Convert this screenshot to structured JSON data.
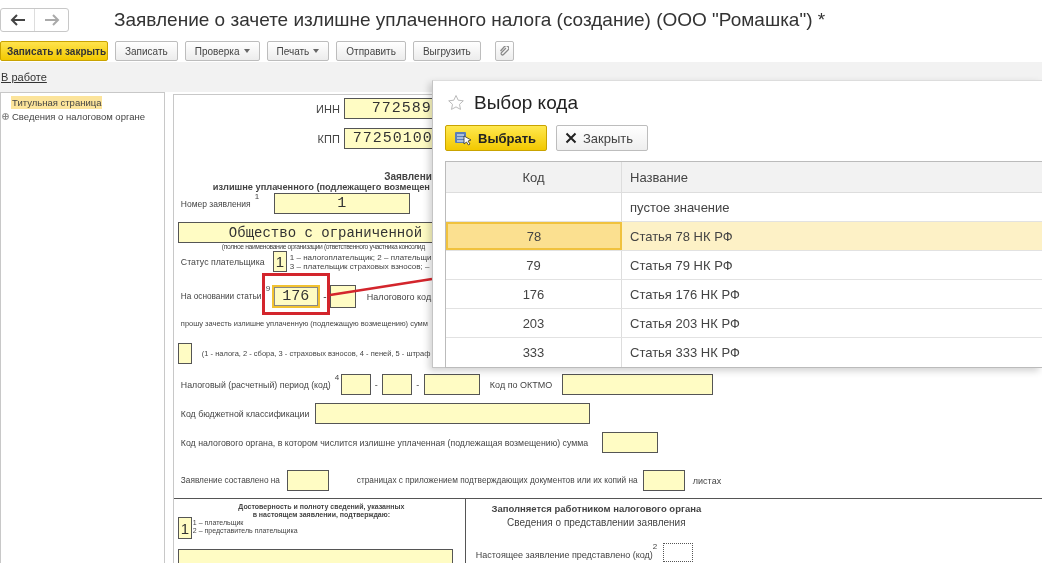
{
  "window": {
    "title": "Заявление о зачете излишне уплаченного налога (создание) (ООО \"Ромашка\") *"
  },
  "toolbar": [
    {
      "label": "Записать и закрыть",
      "kind": "primary"
    },
    {
      "label": "Записать",
      "kind": "button"
    },
    {
      "label": "Проверка",
      "kind": "menu"
    },
    {
      "label": "Печать",
      "kind": "menu"
    },
    {
      "label": "Отправить",
      "kind": "button"
    },
    {
      "label": "Выгрузить",
      "kind": "button"
    },
    {
      "kind": "attach"
    }
  ],
  "status_link": "В работе",
  "sidebar": {
    "items": [
      {
        "label": "Титульная страница",
        "selected": true,
        "expandable": false
      },
      {
        "label": "Сведения о налоговом органе",
        "selected": false,
        "expandable": true
      }
    ]
  },
  "form": {
    "inn": {
      "label": "ИНН",
      "value": "772589"
    },
    "kpp": {
      "label": "КПП",
      "value": "77250100"
    },
    "heading": [
      "Заявлени",
      "излишне уплаченного (подлежащего возмещен"
    ],
    "number": {
      "label": "Номер заявления",
      "note": "1",
      "value": "1"
    },
    "organization": {
      "value": "Общество с ограниченной",
      "caption": "(полное наименование организации (ответственного участника консолид"
    },
    "payer_status": {
      "label": "Статус плательщика",
      "value": "1",
      "legend": [
        "1 – налогоплательщик; 2 – плательщи",
        "3 – плательщик страховых взносов; –"
      ]
    },
    "article": {
      "label": "На основании статьи",
      "note": "9",
      "value": "176",
      "focused": true,
      "separator": "-",
      "next_label": "Налогового код"
    },
    "request": "прошу зачесть излишне уплаченную (подлежащую возмещению) сумм",
    "payment_kind": {
      "legend": "(1 - налога, 2 - сбора, 3 - страховых взносов, 4 - пеней, 5 - штраф"
    },
    "period": {
      "label": "Налоговый (расчетный) период (код)",
      "note": "4",
      "separators": [
        "-",
        "-"
      ]
    },
    "oktmo": {
      "label": "Код по ОКТМО"
    },
    "kbk": {
      "label": "Код бюджетной классификации"
    },
    "tax_office": {
      "label": "Код налогового органа, в котором числится излишне уплаченная (подлежащая возмещению) сумма"
    },
    "pages": {
      "label": "Заявление составлено на",
      "middle": "страницах с приложением подтверждающих документов или их копий на",
      "suffix": "листах"
    },
    "confirmation": {
      "heading": [
        "Достоверность и полноту сведений, указанных",
        "в настоящем заявлении, подтверждаю:"
      ],
      "value": "1",
      "legend": [
        "1 – плательщик",
        "2 – представитель плательщика"
      ]
    },
    "tax_office_section": {
      "title": "Заполняется работником налогового органа",
      "subtitle": "Сведения о представлении заявления",
      "label": "Настоящее заявление представлено (код)",
      "note": "2"
    }
  },
  "dialog": {
    "title": "Выбор кода",
    "buttons": [
      {
        "label": "Выбрать",
        "kind": "select"
      },
      {
        "label": "Закрыть",
        "kind": "close"
      }
    ],
    "columns": [
      "Код",
      "Название"
    ],
    "rows": [
      {
        "name": "пустое значение",
        "selected": false
      },
      {
        "code": "78",
        "name": "Статья 78 НК РФ",
        "selected": true
      },
      {
        "code": "79",
        "name": "Статья 79 НК РФ",
        "selected": false
      },
      {
        "code": "176",
        "name": "Статья 176 НК РФ",
        "selected": false
      },
      {
        "code": "203",
        "name": "Статья 203 НК РФ",
        "selected": false
      },
      {
        "code": "333",
        "name": "Статья 333 НК РФ",
        "selected": false
      }
    ]
  }
}
